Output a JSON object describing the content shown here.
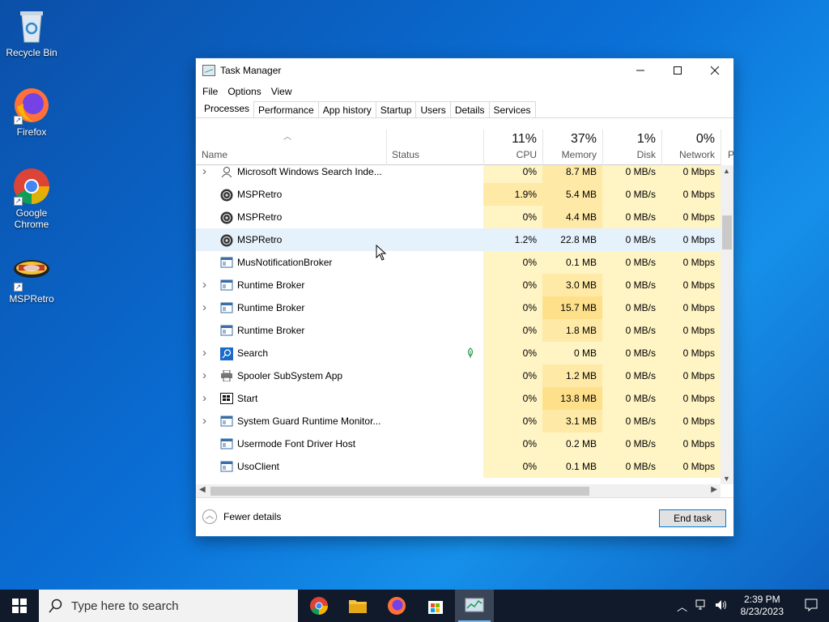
{
  "desktop": {
    "icons": [
      {
        "label": "Recycle Bin"
      },
      {
        "label": "Firefox"
      },
      {
        "label": "Google Chrome"
      },
      {
        "label": "MSPRetro"
      }
    ]
  },
  "window": {
    "title": "Task Manager",
    "menu": [
      "File",
      "Options",
      "View"
    ],
    "tabs": [
      "Processes",
      "Performance",
      "App history",
      "Startup",
      "Users",
      "Details",
      "Services"
    ],
    "active_tab": "Processes",
    "columns": {
      "name": "Name",
      "status": "Status",
      "cpu": {
        "pct": "11%",
        "label": "CPU"
      },
      "memory": {
        "pct": "37%",
        "label": "Memory"
      },
      "disk": {
        "pct": "1%",
        "label": "Disk"
      },
      "network": {
        "pct": "0%",
        "label": "Network"
      },
      "power": "P"
    },
    "processes": [
      {
        "name": "Microsoft Windows Search Inde...",
        "expandable": true,
        "icon": "user-icon",
        "status": "",
        "cpu": "0%",
        "memory": "8.7 MB",
        "disk": "0 MB/s",
        "network": "0 Mbps"
      },
      {
        "name": "MSPRetro",
        "expandable": false,
        "icon": "mspretro-icon",
        "status": "",
        "cpu": "1.9%",
        "memory": "5.4 MB",
        "disk": "0 MB/s",
        "network": "0 Mbps"
      },
      {
        "name": "MSPRetro",
        "expandable": false,
        "icon": "mspretro-icon",
        "status": "",
        "cpu": "0%",
        "memory": "4.4 MB",
        "disk": "0 MB/s",
        "network": "0 Mbps"
      },
      {
        "name": "MSPRetro",
        "expandable": false,
        "icon": "mspretro-icon",
        "status": "",
        "cpu": "1.2%",
        "memory": "22.8 MB",
        "disk": "0 MB/s",
        "network": "0 Mbps"
      },
      {
        "name": "MusNotificationBroker",
        "expandable": false,
        "icon": "window-icon",
        "status": "",
        "cpu": "0%",
        "memory": "0.1 MB",
        "disk": "0 MB/s",
        "network": "0 Mbps"
      },
      {
        "name": "Runtime Broker",
        "expandable": true,
        "icon": "window-icon",
        "status": "",
        "cpu": "0%",
        "memory": "3.0 MB",
        "disk": "0 MB/s",
        "network": "0 Mbps"
      },
      {
        "name": "Runtime Broker",
        "expandable": true,
        "icon": "window-icon",
        "status": "",
        "cpu": "0%",
        "memory": "15.7 MB",
        "disk": "0 MB/s",
        "network": "0 Mbps"
      },
      {
        "name": "Runtime Broker",
        "expandable": false,
        "icon": "window-icon",
        "status": "",
        "cpu": "0%",
        "memory": "1.8 MB",
        "disk": "0 MB/s",
        "network": "0 Mbps"
      },
      {
        "name": "Search",
        "expandable": true,
        "icon": "search-icon",
        "status": "suspended-leaf",
        "cpu": "0%",
        "memory": "0 MB",
        "disk": "0 MB/s",
        "network": "0 Mbps"
      },
      {
        "name": "Spooler SubSystem App",
        "expandable": true,
        "icon": "printer-icon",
        "status": "",
        "cpu": "0%",
        "memory": "1.2 MB",
        "disk": "0 MB/s",
        "network": "0 Mbps"
      },
      {
        "name": "Start",
        "expandable": true,
        "icon": "start-icon",
        "status": "",
        "cpu": "0%",
        "memory": "13.8 MB",
        "disk": "0 MB/s",
        "network": "0 Mbps"
      },
      {
        "name": "System Guard Runtime Monitor...",
        "expandable": true,
        "icon": "window-icon",
        "status": "",
        "cpu": "0%",
        "memory": "3.1 MB",
        "disk": "0 MB/s",
        "network": "0 Mbps"
      },
      {
        "name": "Usermode Font Driver Host",
        "expandable": false,
        "icon": "window-icon",
        "status": "",
        "cpu": "0%",
        "memory": "0.2 MB",
        "disk": "0 MB/s",
        "network": "0 Mbps"
      },
      {
        "name": "UsoClient",
        "expandable": false,
        "icon": "window-icon",
        "status": "",
        "cpu": "0%",
        "memory": "0.1 MB",
        "disk": "0 MB/s",
        "network": "0 Mbps"
      }
    ],
    "fewer_details": "Fewer details",
    "end_task": "End task"
  },
  "taskbar": {
    "search_placeholder": "Type here to search",
    "time": "2:39 PM",
    "date": "8/23/2023"
  },
  "colors": {
    "heat_light": "#fff4c4",
    "heat_mid": "#ffe9a6",
    "heat_strong": "#ffe08a",
    "accent": "#0078d7"
  }
}
